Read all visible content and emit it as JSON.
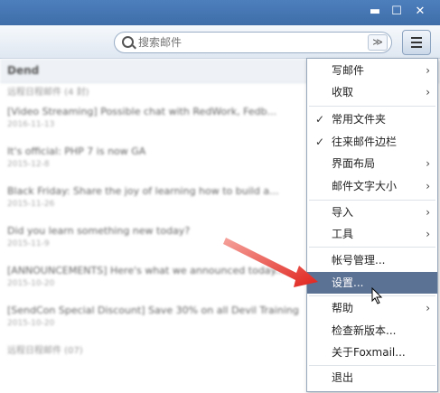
{
  "window": {
    "minimize_glyph": "▬",
    "maximize_glyph": "☐",
    "close_glyph": "✕"
  },
  "search": {
    "placeholder": "搜索邮件",
    "dropdown_glyph": "≫"
  },
  "list": {
    "header": "Dend",
    "group_label_1": "远程日程邮件 (4 封)",
    "group_label_2": "远程日程邮件 (07)",
    "items": [
      {
        "subject": "[Video Streaming] Possible chat with RedWork, Fedb...",
        "date": "2016-11-13"
      },
      {
        "subject": "It's official: PHP 7 is now GA",
        "date": "2015-12-8"
      },
      {
        "subject": "Black Friday: Share the joy of learning how to build a...",
        "date": "2015-11-26"
      },
      {
        "subject": "Did you learn something new today?",
        "date": "2015-11-9"
      },
      {
        "subject": "[ANNOUNCEMENTS] Here's what we announced today...",
        "date": "2015-10-20"
      },
      {
        "subject": "[SendCon Special Discount] Save 30% on all Devil Training",
        "date": "2015-10-20"
      }
    ]
  },
  "menu": {
    "items": [
      {
        "label": "写邮件",
        "arrow": "›"
      },
      {
        "label": "收取",
        "arrow": "›"
      },
      {
        "label": "常用文件夹",
        "check": "✓"
      },
      {
        "label": "往来邮件边栏",
        "check": "✓"
      },
      {
        "label": "界面布局",
        "arrow": "›"
      },
      {
        "label": "邮件文字大小",
        "arrow": "›"
      },
      {
        "label": "导入",
        "arrow": "›"
      },
      {
        "label": "工具",
        "arrow": "›"
      },
      {
        "label": "帐号管理..."
      },
      {
        "label": "设置..."
      },
      {
        "label": "帮助",
        "arrow": "›"
      },
      {
        "label": "检查新版本..."
      },
      {
        "label": "关于Foxmail..."
      },
      {
        "label": "退出"
      }
    ]
  },
  "colors": {
    "titlebar": "#4677b5",
    "highlight": "#5c7294",
    "arrow_red": "#e0231c"
  }
}
